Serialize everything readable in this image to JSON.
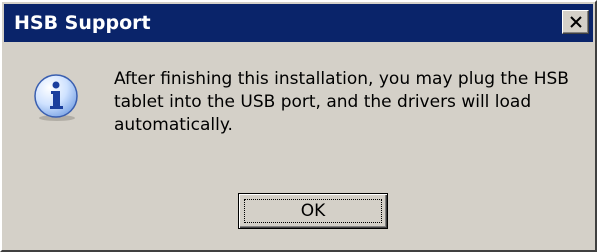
{
  "dialog": {
    "title": "HSB Support",
    "message": "After finishing this installation, you may plug the HSB tablet into the USB port, and the drivers will load automatically.",
    "icon": "information-icon",
    "close_icon": "close-icon",
    "buttons": {
      "ok_label": "OK"
    }
  },
  "colors": {
    "titlebar": "#0a246a",
    "face": "#d4d0c8",
    "title_text": "#ffffff"
  }
}
